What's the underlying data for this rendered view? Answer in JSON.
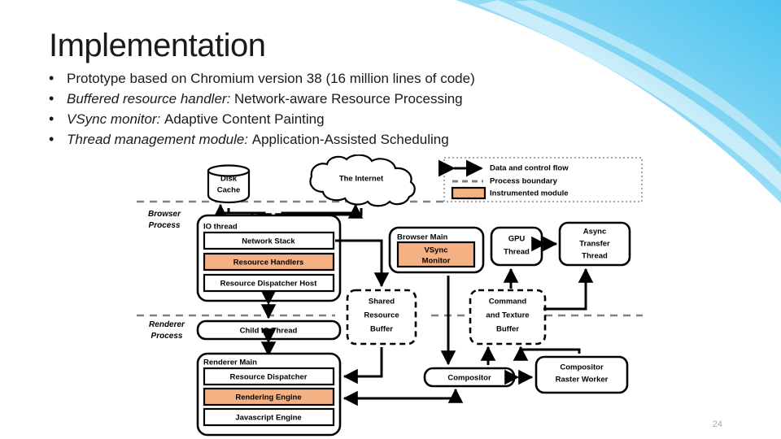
{
  "slide": {
    "title": "Implementation",
    "page_number": "24",
    "bullet_marker": "•",
    "bullets": [
      {
        "emphasis": "",
        "text": "Prototype based on Chromium version 38 (16 million lines of code)"
      },
      {
        "emphasis": "Buffered resource handler:",
        "text": "Network-aware Resource Processing"
      },
      {
        "emphasis": "VSync monitor:",
        "text": "Adaptive Content Painting"
      },
      {
        "emphasis": "Thread management module:",
        "text": "Application-Assisted Scheduling"
      }
    ]
  },
  "colors": {
    "instrumented_module": "#f4b183",
    "process_boundary": "#808080",
    "flow_arrow": "#000000",
    "background_swoosh": "#5bc8f0",
    "page_number": "#a9a9a9"
  },
  "diagram": {
    "legend": {
      "items": [
        {
          "symbol": "double-arrow",
          "label": "Data and control flow"
        },
        {
          "symbol": "dashed-line",
          "label": "Process boundary"
        },
        {
          "symbol": "orange-swatch",
          "label": "Instrumented module"
        }
      ]
    },
    "process_labels": [
      {
        "line1": "Browser",
        "line2": "Process"
      },
      {
        "line1": "Renderer",
        "line2": "Process"
      }
    ],
    "external": [
      {
        "id": "disk-cache",
        "shape": "cylinder",
        "line1": "Disk",
        "line2": "Cache"
      },
      {
        "id": "the-internet",
        "shape": "cloud",
        "label": "The Internet"
      }
    ],
    "groups": [
      {
        "id": "io-thread",
        "title": "IO thread",
        "children": [
          {
            "id": "network-stack",
            "label": "Network Stack",
            "instrumented": false
          },
          {
            "id": "resource-handlers",
            "label": "Resource Handlers",
            "instrumented": true
          },
          {
            "id": "resource-dispatcher-host",
            "label": "Resource Dispatcher Host",
            "instrumented": false
          }
        ]
      },
      {
        "id": "browser-main",
        "title": "Browser Main",
        "children": [
          {
            "id": "vsync-monitor",
            "line1": "VSync",
            "line2": "Monitor",
            "instrumented": true
          }
        ]
      },
      {
        "id": "renderer-main",
        "title": "Renderer Main",
        "children": [
          {
            "id": "resource-dispatcher",
            "label": "Resource Dispatcher",
            "instrumented": false
          },
          {
            "id": "rendering-engine",
            "label": "Rendering Engine",
            "instrumented": true
          },
          {
            "id": "javascript-engine",
            "label": "Javascript Engine",
            "instrumented": false
          }
        ]
      }
    ],
    "nodes": [
      {
        "id": "gpu-thread",
        "line1": "GPU",
        "line2": "Thread",
        "line3": ""
      },
      {
        "id": "async-transfer-thread",
        "line1": "Async",
        "line2": "Transfer",
        "line3": "Thread"
      },
      {
        "id": "child-io-thread",
        "label": "Child IO Thread"
      },
      {
        "id": "shared-resource-buffer",
        "line1": "Shared",
        "line2": "Resource",
        "line3": "Buffer",
        "dashed": true
      },
      {
        "id": "command-and-texture-buffer",
        "line1": "Command",
        "line2": "and Texture",
        "line3": "Buffer",
        "dashed": true
      },
      {
        "id": "compositor",
        "label": "Compositor"
      },
      {
        "id": "compositor-raster-worker",
        "line1": "Compositor",
        "line2": "Raster Worker"
      }
    ]
  }
}
